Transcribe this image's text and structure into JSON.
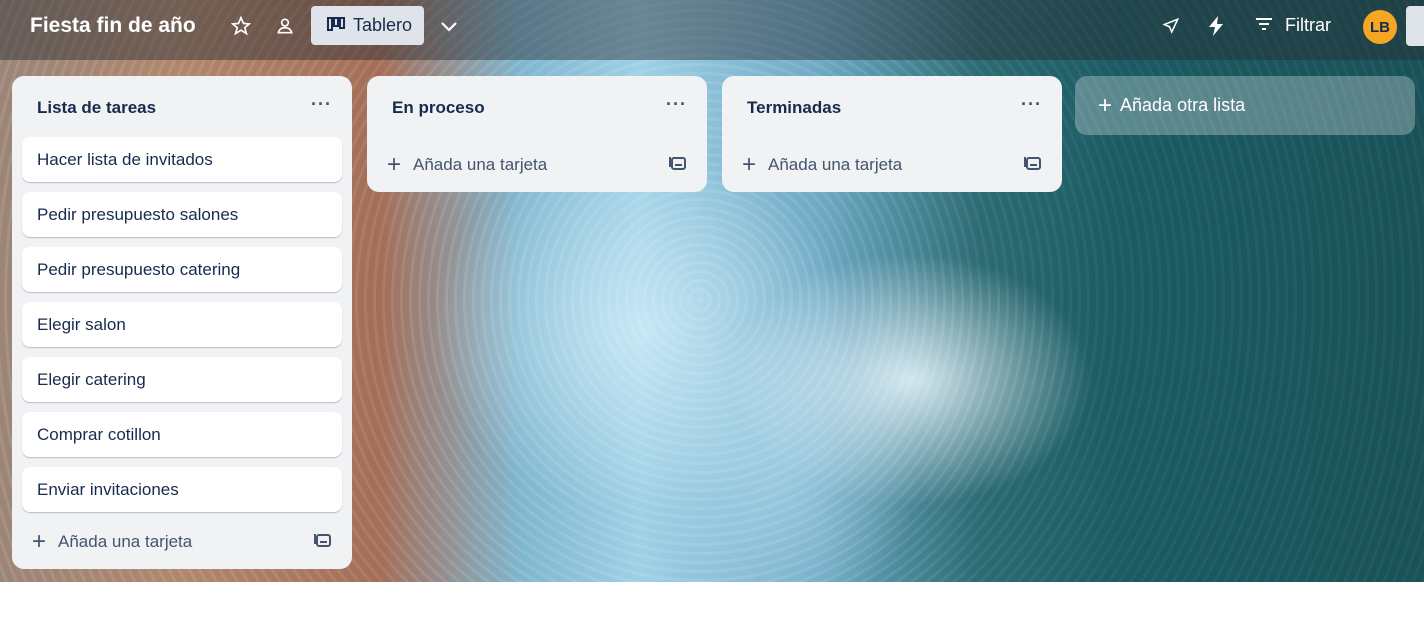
{
  "board": {
    "title": "Fiesta fin de año",
    "view_label": "Tablero",
    "filter_label": "Filtrar",
    "avatar_initials": "LB",
    "avatar_color": "#f5a623"
  },
  "icons": {
    "star": "star-icon",
    "workspace": "workspace-visibility-icon",
    "board_view": "board-view-icon",
    "chevron": "chevron-down-icon",
    "power_ups": "rocket-icon",
    "automation": "lightning-icon",
    "filter": "filter-icon",
    "menu": "ellipsis-icon",
    "template": "card-template-icon",
    "plus": "plus-icon"
  },
  "lists": [
    {
      "title": "Lista de tareas",
      "menu": "···",
      "cards": [
        "Hacer lista de invitados",
        "Pedir presupuesto salones",
        "Pedir presupuesto catering",
        "Elegir salon",
        "Elegir catering",
        "Comprar cotillon",
        "Enviar invitaciones"
      ],
      "add_card": "Añada una tarjeta"
    },
    {
      "title": "En proceso",
      "menu": "···",
      "cards": [],
      "add_card": "Añada una tarjeta"
    },
    {
      "title": "Terminadas",
      "menu": "···",
      "cards": [],
      "add_card": "Añada una tarjeta"
    }
  ],
  "add_list": {
    "plus": "+",
    "label": "Añada otra lista"
  }
}
